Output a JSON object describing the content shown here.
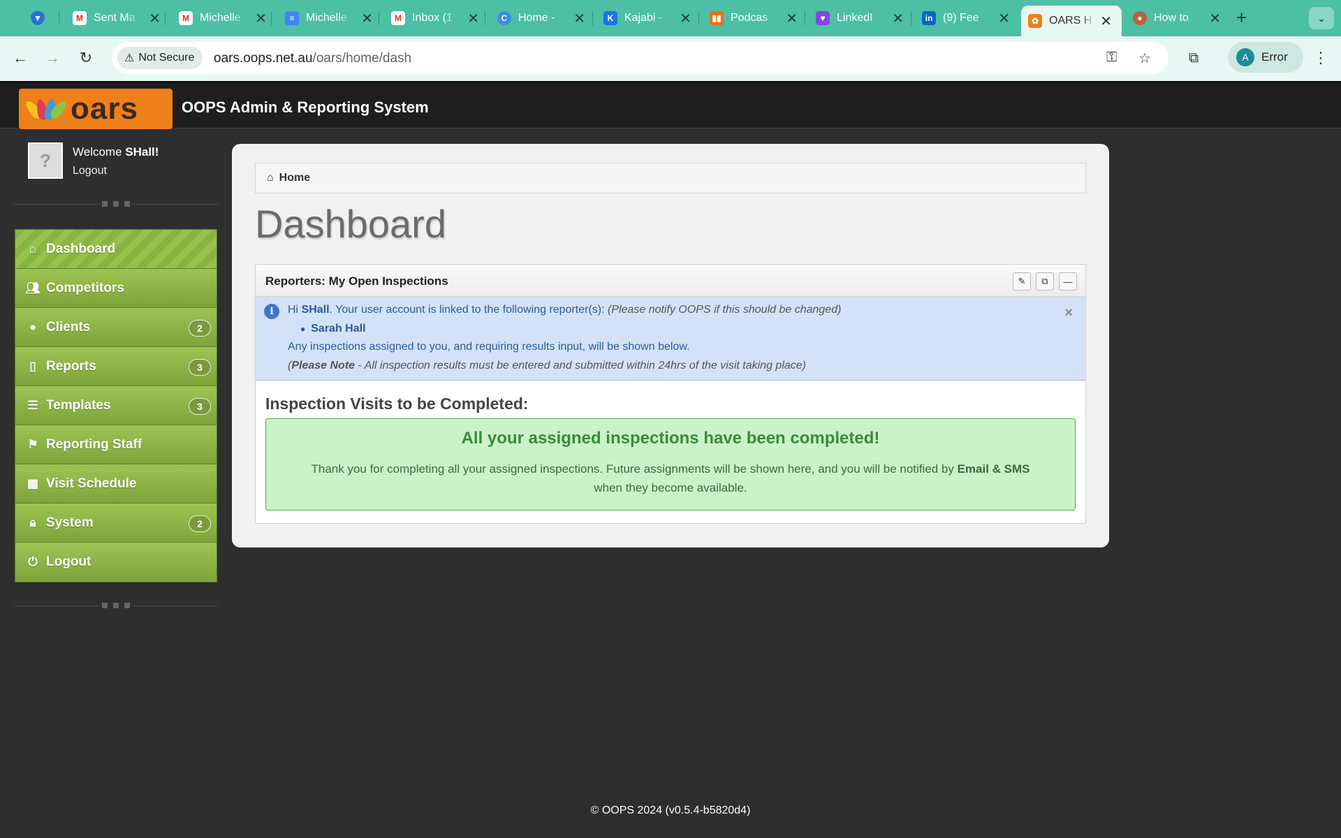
{
  "browser": {
    "tabs": [
      {
        "title": "",
        "icon": "shield-icon",
        "color": "#2a6fd6"
      },
      {
        "title": "Sent Ma",
        "icon": "gmail-icon",
        "color": "#d93025"
      },
      {
        "title": "Michelle",
        "icon": "gmail-icon",
        "color": "#d93025"
      },
      {
        "title": "Michelle",
        "icon": "docs-icon",
        "color": "#4285f4"
      },
      {
        "title": "Inbox (1",
        "icon": "gmail-icon",
        "color": "#d93025"
      },
      {
        "title": "Home -",
        "icon": "canva-icon",
        "color": "#3b8be8"
      },
      {
        "title": "Kajabi -",
        "icon": "kajabi-icon",
        "color": "#1c73e8"
      },
      {
        "title": "Podcas",
        "icon": "trello-icon",
        "color": "#e8701a"
      },
      {
        "title": "LinkedI",
        "icon": "heart-icon",
        "color": "#7b4ce0"
      },
      {
        "title": "(9) Fee",
        "icon": "linkedin-icon",
        "color": "#0a66c2"
      },
      {
        "title": "OARS H",
        "icon": "oars-icon",
        "color": "#ef7f1a"
      },
      {
        "title": "How to",
        "icon": "avatar-icon",
        "color": "#b8643c"
      }
    ],
    "security_label": "Not Secure",
    "url_host": "oars.oops.net.au",
    "url_path": "/oars/home/dash",
    "profile_initial": "A",
    "profile_status": "Error"
  },
  "app": {
    "logo_text": "oars",
    "title": "OOPS Admin & Reporting System",
    "accent": "#ef7f1a"
  },
  "user": {
    "welcome_prefix": "Welcome ",
    "username": "SHall!",
    "logout": "Logout"
  },
  "menu": {
    "items": [
      {
        "label": "Dashboard",
        "icon": "home-icon",
        "badge": null,
        "active": true
      },
      {
        "label": "Competitors",
        "icon": "users-icon",
        "badge": null
      },
      {
        "label": "Clients",
        "icon": "user-icon",
        "badge": "2"
      },
      {
        "label": "Reports",
        "icon": "file-icon",
        "badge": "3"
      },
      {
        "label": "Templates",
        "icon": "list-icon",
        "badge": "3"
      },
      {
        "label": "Reporting Staff",
        "icon": "flag-icon",
        "badge": null
      },
      {
        "label": "Visit Schedule",
        "icon": "calendar-icon",
        "badge": null
      },
      {
        "label": "System",
        "icon": "lock-icon",
        "badge": "2"
      },
      {
        "label": "Logout",
        "icon": "power-icon",
        "badge": null
      }
    ],
    "color": "#8db446"
  },
  "breadcrumb": {
    "home": "Home"
  },
  "page_title": "Dashboard",
  "widget": {
    "title": "Reporters: My Open Inspections",
    "info": {
      "hi": "Hi ",
      "user": "SHall",
      "linked_text": ". Your user account is linked to the following reporter(s): ",
      "notify": "(Please notify OOPS if this should be changed)",
      "reporter": "Sarah Hall",
      "assigned_text": "Any inspections assigned to you, and requiring results input, will be shown below.",
      "note_open": "(",
      "note_label": "Please Note",
      "note_text": " - All inspection results must be entered and submitted within 24hrs of the visit taking place)"
    },
    "section_title": "Inspection Visits to be Completed:",
    "success": {
      "heading": "All your assigned inspections have been completed!",
      "text_1": "Thank you for completing all your assigned inspections. Future assignments will be shown here, and you will be notified by ",
      "bold": "Email & SMS",
      "text_2": " when they become available."
    }
  },
  "footer": "© OOPS 2024 (v0.5.4-b5820d4)"
}
